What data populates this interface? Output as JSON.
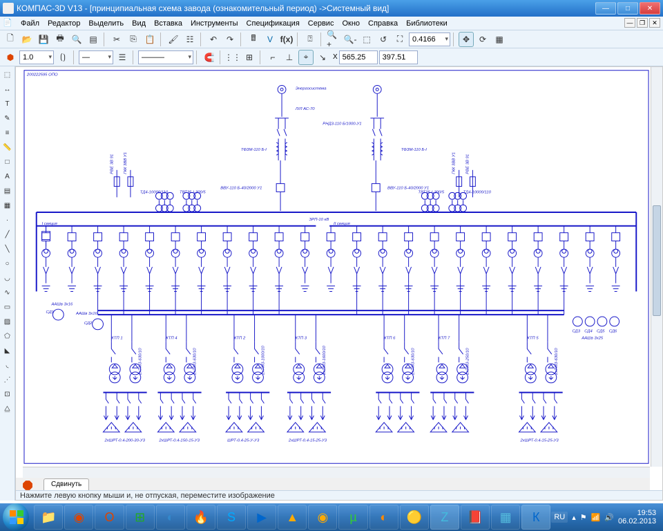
{
  "titlebar": {
    "title": "КОМПАС-3D V13 - [принципиальная схема завода (ознакомительный период) ->Системный вид]"
  },
  "menu": {
    "items": [
      "Файл",
      "Редактор",
      "Выделить",
      "Вид",
      "Вставка",
      "Инструменты",
      "Спецификация",
      "Сервис",
      "Окно",
      "Справка",
      "Библиотеки"
    ]
  },
  "toolbar1": {
    "zoom": "0.4166"
  },
  "toolbar2": {
    "style": "1.0",
    "x": "565.25",
    "y": "397.51"
  },
  "tabs": {
    "active": "Сдвинуть"
  },
  "status": {
    "hint": "Нажмите левую кнопку мыши и, не отпуская, переместите изображение"
  },
  "schematic": {
    "top_label1": "Энергосистема",
    "top_label2": "Л/Л АС-70",
    "top_label3": "РНД3-110 Б/1000-У1",
    "top_label4": "ТФЗМ-110 Б-I",
    "top_label5": "ТФЗМ-110 Б-I",
    "top_label6": "ВВУ-110 Б-40/2000 У1",
    "top_label7": "ВВУ-110 Б-40/2000 У1",
    "bus_label": "ЗРП-10 кВ",
    "left_label1": "I секция",
    "right_label1": "II секция",
    "t_left1": "ТД4-10000/110",
    "t_left2": "ТВТ35-I-300/5",
    "t_right1": "ТВТ35-I-300/5",
    "t_right2": "ТД4-10000/110",
    "pk": "РВЕ 3В 91",
    "pk2": "ГКК 3ВВ У1",
    "pk3": "ГКК 3ВВ У1",
    "pk4": "РВЕ 3В 91",
    "sd1": "СД1",
    "sd2": "СД2",
    "sd3": "СД3",
    "sd4": "СД4",
    "sd5": "СД5",
    "sd6": "СД6",
    "aashv1": "ААШв 3x16",
    "aashv2": "ААШв 3x16",
    "aashv3": "ААШв 3x25",
    "ktp1": "КТП 1",
    "ktp2": "КТП 4",
    "ktp3": "КТП 2",
    "ktp4": "КТП 3",
    "ktp5": "КТП 6",
    "ktp6": "КТП 7",
    "ktp7": "КТП 5",
    "tr1": "2хТМЗ-630/10",
    "tr2": "2хТМЗ-630/10",
    "tr3": "2хТМЗ-1000/10",
    "tr4": "2хТМЗ-1600/10",
    "tr5": "2хТМЗ-630/10",
    "tr6": "2хТМЗ-250/10",
    "tr7": "2хТМЗ-630/10",
    "sh1": "2хШРТ-0.4-200-30-У3",
    "sh2": "2хШРТ-0.4-150-15-У3",
    "sh3": "ШРТ-0.4-25-У-У3",
    "sh4": "2хШРТ-0.4-15-25-У3",
    "sh7": "2хШРТ-0.4-15-25-У3"
  },
  "taskbar": {
    "lang": "RU",
    "time": "19:53",
    "date": "06.02.2013"
  }
}
